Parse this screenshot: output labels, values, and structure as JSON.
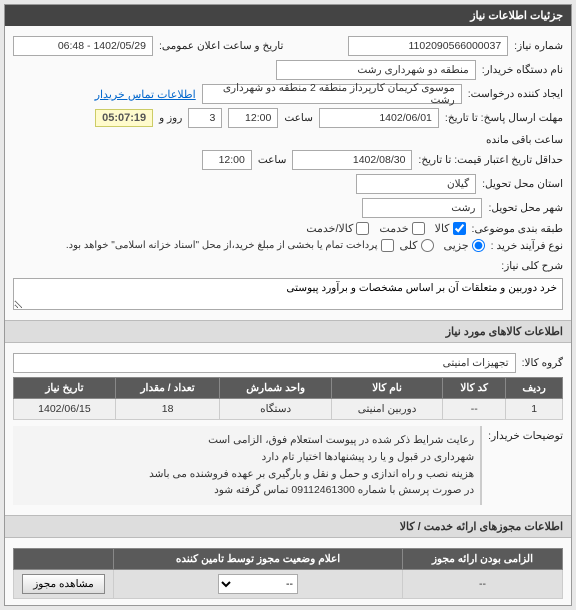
{
  "meta": {
    "panel_title": "جزئیات اطلاعات نیاز",
    "need_number_label": "شماره نیاز:",
    "need_number": "1102090566000037",
    "public_announce_label": "تاریخ و ساعت اعلان عمومی:",
    "public_announce": "1402/05/29 - 06:48",
    "buyer_org_label": "نام دستگاه خریدار:",
    "buyer_org": "منطقه دو شهرداری رشت",
    "requester_label": "ایجاد کننده درخواست:",
    "requester": "موسوی کریمان کارپرداز منطقه 2 منطقه دو شهرداری رشت",
    "contact_link": "اطلاعات تماس خریدار",
    "reply_deadline_label": "مهلت ارسال پاسخ: تا تاریخ:",
    "reply_deadline_date": "1402/06/01",
    "time_label": "ساعت",
    "reply_deadline_time": "12:00",
    "days_left": "3",
    "days_unit": "روز و",
    "countdown": "05:07:19",
    "countdown_suffix": "ساعت باقی مانده",
    "validity_label": "حداقل تاریخ اعتبار قیمت: تا تاریخ:",
    "validity_date": "1402/08/30",
    "validity_time": "12:00",
    "province_label": "استان محل تحویل:",
    "province": "گیلان",
    "city_label": "شهر محل تحویل:",
    "city": "رشت",
    "category_label": "طبقه بندی موضوعی:",
    "category_goods": "کالا",
    "category_service": "خدمت",
    "category_goods_service": "کالا/خدمت",
    "purchase_type_label": "نوع فرآیند خرید :",
    "partial": "جزیی",
    "full": "کلی",
    "payment_note": "پرداخت تمام یا بخشی از مبلغ خرید،از محل \"اسناد خزانه اسلامی\" خواهد بود.",
    "need_desc_label": "شرح کلی نیاز:",
    "need_desc": "خرد دوربین و متعلقات آن بر اساس مشخصات و برآورد پیوستی",
    "items_header": "اطلاعات کالاهای مورد نیاز",
    "goods_group_label": "گروه کالا:",
    "goods_group": "تجهیزات امنیتی",
    "table": {
      "headers": [
        "ردیف",
        "کد کالا",
        "نام کالا",
        "واحد شمارش",
        "تعداد / مقدار",
        "تاریخ نیاز"
      ],
      "rows": [
        {
          "row": "1",
          "code": "--",
          "name": "دوربین امنیتی",
          "unit": "دستگاه",
          "qty": "18",
          "date": "1402/06/15"
        }
      ]
    },
    "buyer_notes_label": "توضیحات خریدار:",
    "buyer_notes_lines": [
      "رعایت شرایط ذکر شده در پیوست استعلام فوق، الزامی است",
      "شهرداری در قبول و یا رد پیشنهادها اختیار تام دارد",
      "هزینه نصب و راه اندازی و حمل و نقل و بارگیری بر عهده فروشنده می باشد",
      "در صورت پرسش با شماره 09112461300 تماس گرفته شود"
    ],
    "permits_header": "اطلاعات مجوزهای ارائه خدمت / کالا",
    "permit_table": {
      "headers": [
        "الزامی بودن ارائه مجوز",
        "اعلام وضعیت مجوز توسط تامین کننده",
        ""
      ],
      "row": {
        "mandatory": "--",
        "status_placeholder": "--",
        "button": "مشاهده مجوز"
      }
    }
  },
  "chart_data": null
}
